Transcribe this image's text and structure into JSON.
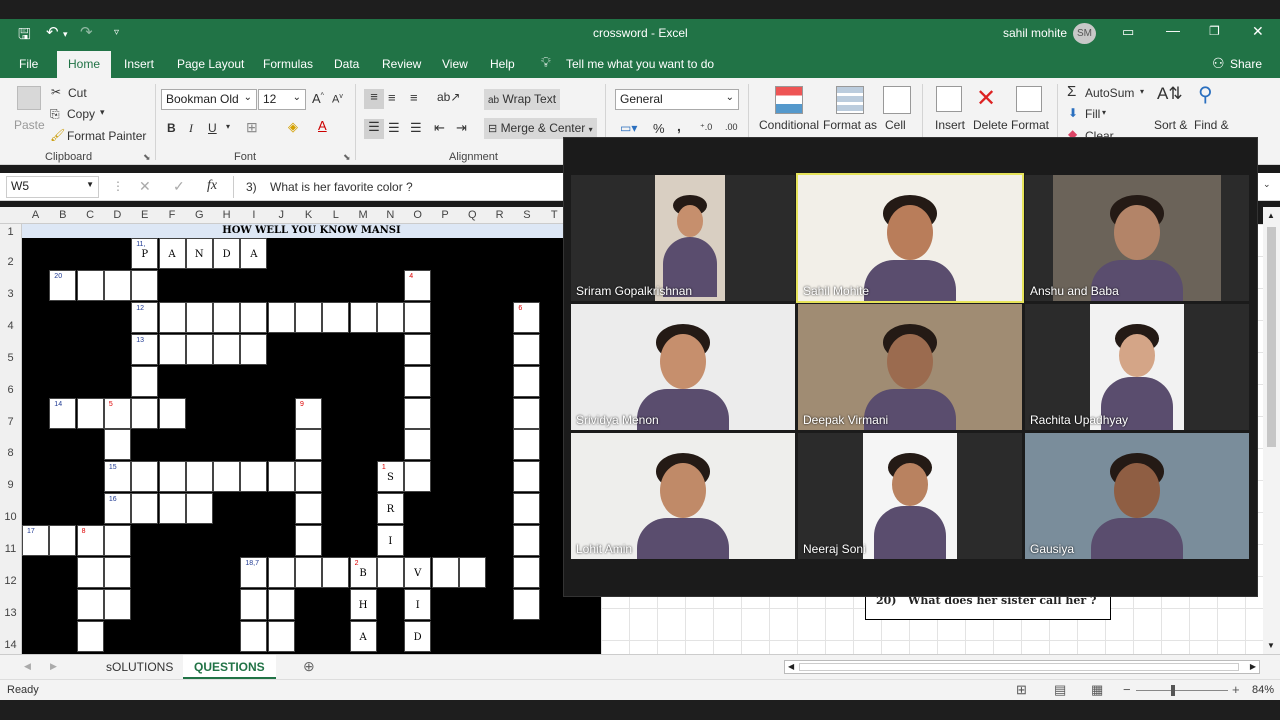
{
  "window": {
    "title": "crossword  -  Excel",
    "user": "sahil mohite",
    "user_initials": "SM"
  },
  "tabs": [
    "File",
    "Home",
    "Insert",
    "Page Layout",
    "Formulas",
    "Data",
    "Review",
    "View",
    "Help"
  ],
  "tell_me": "Tell me what you want to do",
  "share": "Share",
  "ribbon": {
    "clipboard": {
      "paste": "Paste",
      "cut": "Cut",
      "copy": "Copy",
      "format_painter": "Format Painter",
      "group": "Clipboard"
    },
    "font": {
      "name": "Bookman Old",
      "size": "12",
      "bold": "B",
      "italic": "I",
      "underline": "U",
      "group": "Font"
    },
    "alignment": {
      "wrap": "Wrap Text",
      "merge": "Merge & Center",
      "group": "Alignment"
    },
    "number": {
      "format": "General",
      "percent": "%",
      "comma": ","
    },
    "styles": {
      "conditional": "Conditional",
      "format_as": "Format as",
      "cell": "Cell"
    },
    "cells": {
      "insert": "Insert",
      "delete": "Delete",
      "format": "Format"
    },
    "editing": {
      "autosum": "AutoSum",
      "fill": "Fill",
      "clear": "Clear",
      "sort": "Sort &",
      "find": "Find &"
    }
  },
  "formula_bar": {
    "name_box": "W5",
    "fx": "fx",
    "content": "3)    What is her favorite color ?"
  },
  "columns": [
    "A",
    "B",
    "C",
    "D",
    "E",
    "F",
    "G",
    "H",
    "I",
    "J",
    "K",
    "L",
    "M",
    "N",
    "O",
    "P",
    "Q",
    "R",
    "S",
    "T"
  ],
  "rows": [
    "1",
    "2",
    "3",
    "4",
    "5",
    "6",
    "7",
    "8",
    "9",
    "10",
    "11",
    "12",
    "13",
    "14"
  ],
  "puzzle_title": "HOW WELL YOU KNOW MANSI",
  "question_20": "20)   What does her sister call her ?",
  "sheet_tabs": [
    "sOLUTIONS",
    "QUESTIONS"
  ],
  "status": {
    "ready": "Ready",
    "zoom": "84%"
  },
  "participants": [
    {
      "name": "Sriram Gopalkrishnan"
    },
    {
      "name": "Sahil Mohite"
    },
    {
      "name": "Anshu and Baba"
    },
    {
      "name": "Srividya Menon"
    },
    {
      "name": "Deepak Virmani"
    },
    {
      "name": "Rachita Upadhyay"
    },
    {
      "name": "Lohit Amin"
    },
    {
      "name": "Neeraj Soni"
    },
    {
      "name": "Gausiya"
    }
  ],
  "cell_labels": {
    "n11": "11,",
    "n20": "20",
    "n4": "4",
    "n12": "12",
    "n6": "6",
    "n13": "13",
    "n14": "14",
    "n5": "5",
    "n9": "9",
    "n15": "15",
    "n1": "1",
    "n16": "16",
    "n17": "17",
    "n8": "8",
    "n18": "18,7",
    "n2": "2",
    "l_P": "P",
    "l_A1": "A",
    "l_N": "N",
    "l_D1": "D",
    "l_A2": "A",
    "l_S": "S",
    "l_R": "R",
    "l_I1": "I",
    "l_V": "V",
    "l_I2": "I",
    "l_D2": "D",
    "l_B": "B",
    "l_H": "H",
    "l_A3": "A"
  }
}
